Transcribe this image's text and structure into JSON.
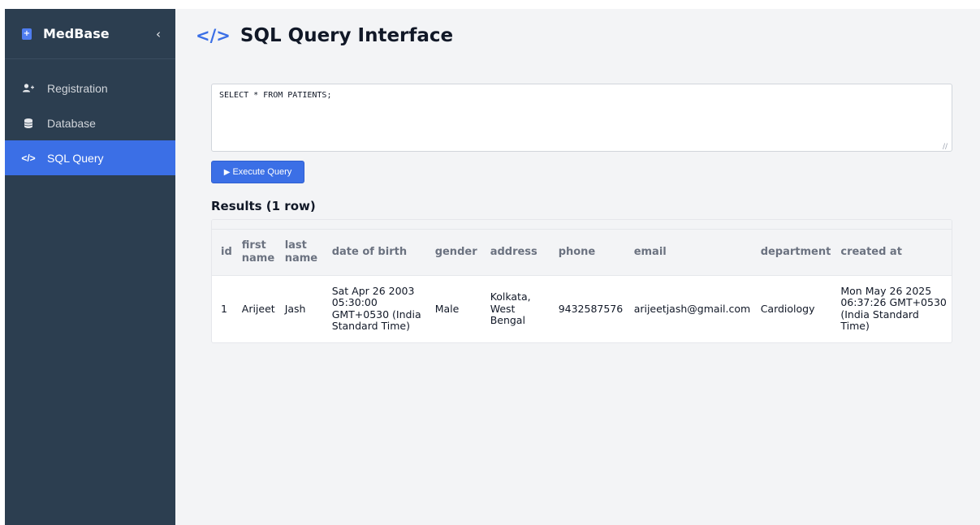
{
  "sidebar": {
    "brand": "MedBase",
    "collapse_icon": "chevron-left-icon",
    "items": [
      {
        "label": "Registration",
        "icon": "user-plus-icon"
      },
      {
        "label": "Database",
        "icon": "database-icon"
      },
      {
        "label": "SQL Query",
        "icon": "code-icon",
        "active": true
      }
    ]
  },
  "main": {
    "title_icon": "</>",
    "title": "SQL Query Interface",
    "query": "SELECT * FROM PATIENTS;",
    "execute_label": "Execute Query",
    "results_title": "Results (1 row)",
    "table": {
      "columns": [
        "id",
        "first name",
        "last name",
        "date of birth",
        "gender",
        "address",
        "phone",
        "email",
        "department",
        "created at"
      ],
      "rows": [
        [
          "1",
          "Arijeet",
          "Jash",
          "Sat Apr 26 2003 05:30:00 GMT+0530 (India Standard Time)",
          "Male",
          "Kolkata, West Bengal",
          "9432587576",
          "arijeetjash@gmail.com",
          "Cardiology",
          "Mon May 26 2025 06:37:26 GMT+0530 (India Standard Time)"
        ]
      ]
    }
  },
  "colors": {
    "sidebar_bg": "#2c3e50",
    "accent": "#3b6fe6",
    "page_bg": "#f3f4f6"
  }
}
